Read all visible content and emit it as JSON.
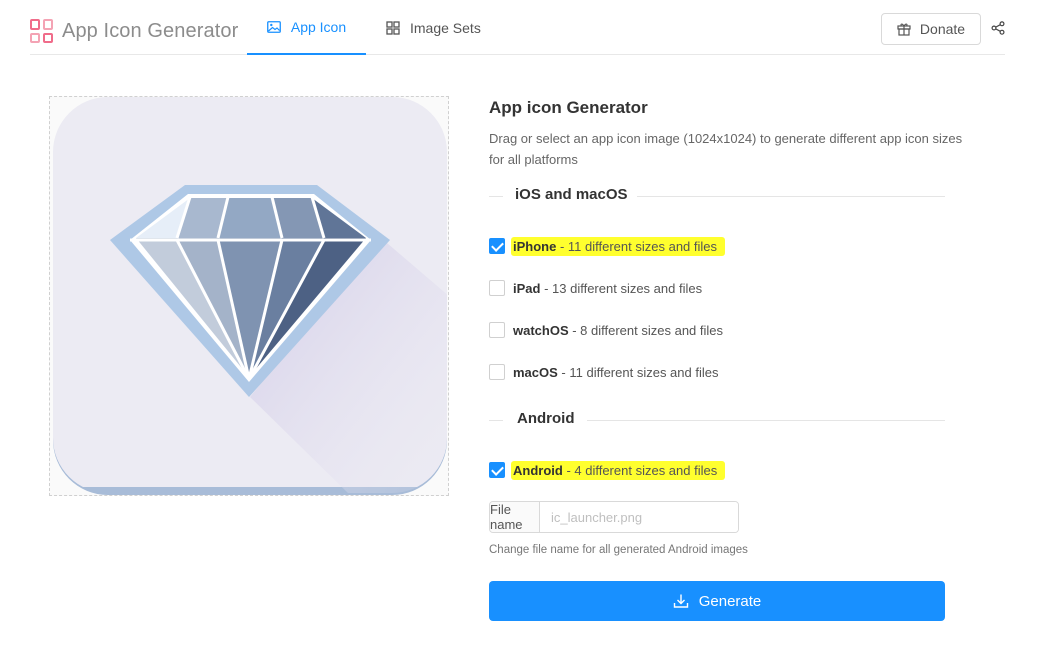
{
  "header": {
    "brand_title": "App Icon Generator",
    "tabs": [
      {
        "label": "App Icon",
        "icon": "image-icon",
        "active": true
      },
      {
        "label": "Image Sets",
        "icon": "grid-icon",
        "active": false
      }
    ],
    "donate_label": "Donate"
  },
  "panel": {
    "title": "App icon Generator",
    "description": "Drag or select an app icon image (1024x1024) to generate different app icon sizes for all platforms",
    "ios_section": "iOS and macOS",
    "android_section": "Android",
    "options": {
      "iphone": {
        "name": "iPhone",
        "detail": " - 11 different sizes and files",
        "checked": true
      },
      "ipad": {
        "name": "iPad",
        "detail": " - 13 different sizes and files",
        "checked": false
      },
      "watchos": {
        "name": "watchOS",
        "detail": " - 8 different sizes and files",
        "checked": false
      },
      "macos": {
        "name": "macOS",
        "detail": " - 11 different sizes and files",
        "checked": false
      },
      "android": {
        "name": "Android",
        "detail": " - 4 different sizes and files",
        "checked": true
      }
    },
    "file_name": {
      "label": "File name",
      "placeholder": "ic_launcher.png",
      "value": "",
      "help": "Change file name for all generated Android images"
    },
    "generate_label": "Generate"
  },
  "colors": {
    "accent": "#1890ff",
    "highlight": "#ffff2e",
    "brand_logo": "#f06c8a"
  }
}
